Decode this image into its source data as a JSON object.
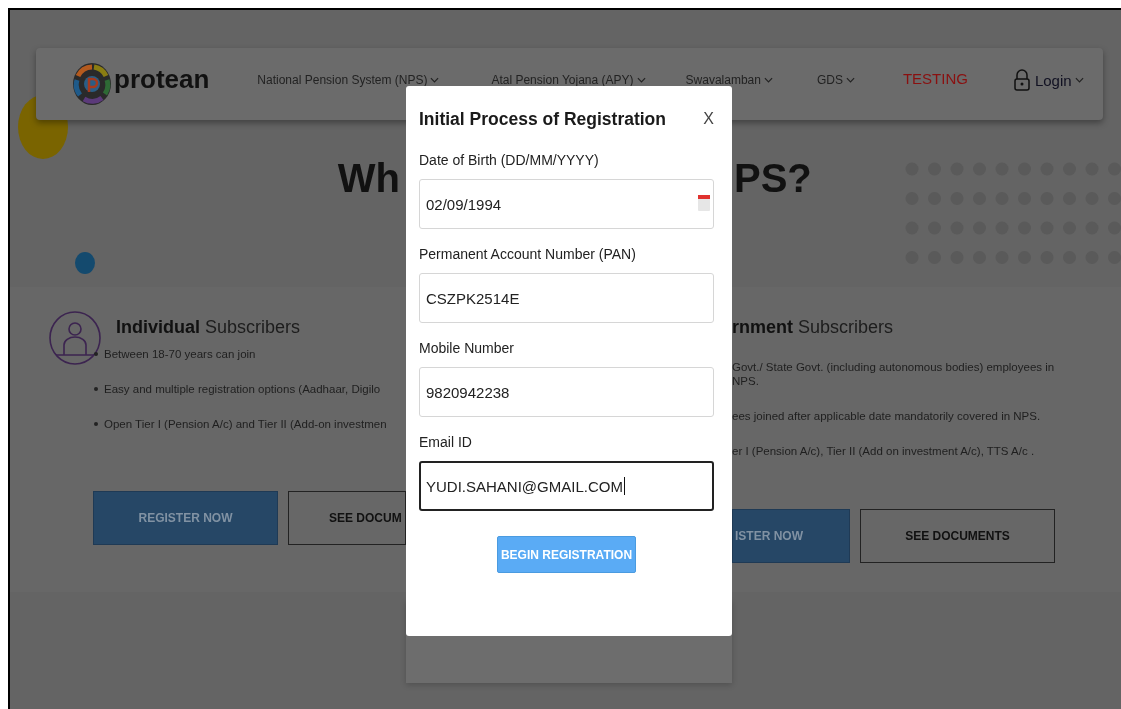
{
  "nav": {
    "brand": "protean",
    "items": [
      {
        "label": "National Pension System (NPS)",
        "kind": "menu"
      },
      {
        "label": "Atal Pension Yojana (APY)",
        "kind": "menu"
      },
      {
        "label": "Swavalamban",
        "kind": "menu"
      },
      {
        "label": "GDS",
        "kind": "menu"
      },
      {
        "label": "TESTING",
        "kind": "highlight"
      }
    ],
    "login": "Login"
  },
  "hero": {
    "heading_left": "Wh",
    "heading_right": "PS?"
  },
  "individual": {
    "title_bold": "Individual",
    "title_rest": "Subscribers",
    "bullets": [
      "Between 18-70 years can join",
      "Easy and multiple registration options (Aadhaar, Digilo",
      "Open Tier I (Pension A/c) and Tier II (Add-on investmen"
    ],
    "buttons": [
      {
        "label": "REGISTER NOW",
        "kind": "primary"
      },
      {
        "label": "SEE DOCUM",
        "kind": "outline"
      }
    ]
  },
  "government": {
    "title_bold": "rnment",
    "title_rest": "Subscribers",
    "bullets": [
      "Govt./ State Govt. (including autonomous bodies) employees in NPS.",
      "ees joined after applicable date mandatorily covered in NPS.",
      "er I (Pension A/c), Tier II (Add on investment A/c), TTS A/c ."
    ],
    "buttons": [
      {
        "label": "ISTER NOW",
        "kind": "primary"
      },
      {
        "label": "SEE DOCUMENTS",
        "kind": "outline"
      }
    ]
  },
  "modal": {
    "title": "Initial Process of Registration",
    "close": "X",
    "fields": [
      {
        "label": "Date of Birth (DD/MM/YYYY)",
        "value": "02/09/1994",
        "kind": "date",
        "focused": false
      },
      {
        "label": "Permanent Account Number (PAN)",
        "value": "CSZPK2514E",
        "kind": "text",
        "focused": false
      },
      {
        "label": "Mobile Number",
        "value": "9820942238",
        "kind": "text",
        "focused": false
      },
      {
        "label": "Email ID",
        "value": "YUDI.SAHANI@GMAIL.COM",
        "kind": "text",
        "focused": true
      }
    ],
    "submit": "BEGIN REGISTRATION"
  }
}
